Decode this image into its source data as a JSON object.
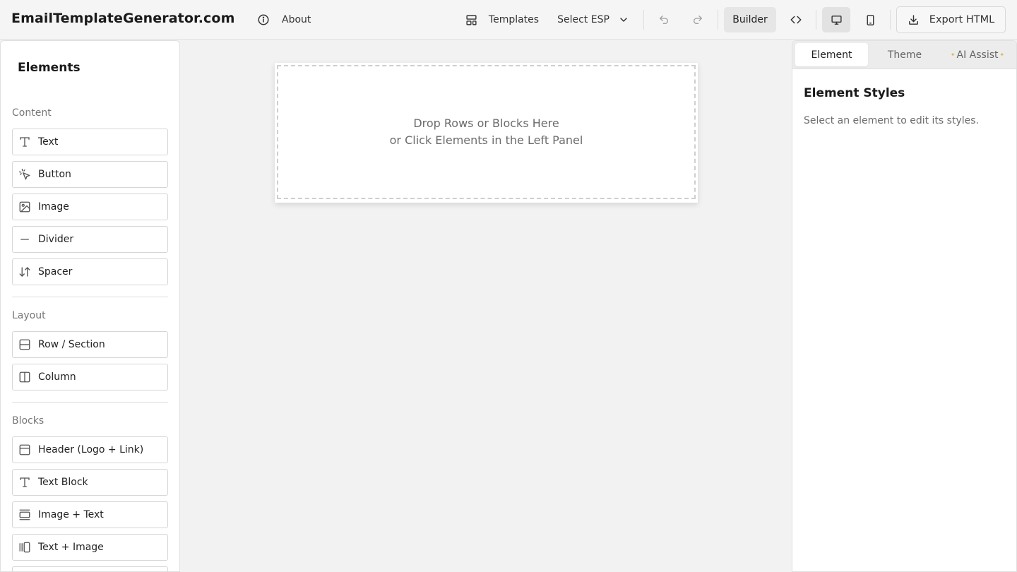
{
  "header": {
    "brand": "EmailTemplateGenerator.com",
    "about_label": "About",
    "templates_label": "Templates",
    "esp_label": "Select ESP",
    "builder_label": "Builder",
    "export_label": "Export HTML",
    "active_view": "Builder",
    "active_device": "desktop"
  },
  "left_panel": {
    "title": "Elements",
    "sections": {
      "content": {
        "label": "Content",
        "items": [
          {
            "label": "Text",
            "icon": "text-icon"
          },
          {
            "label": "Button",
            "icon": "pointer-click-icon"
          },
          {
            "label": "Image",
            "icon": "image-icon"
          },
          {
            "label": "Divider",
            "icon": "minus-icon"
          },
          {
            "label": "Spacer",
            "icon": "arrows-vertical-icon"
          }
        ]
      },
      "layout": {
        "label": "Layout",
        "items": [
          {
            "label": "Row / Section",
            "icon": "row-icon"
          },
          {
            "label": "Column",
            "icon": "column-icon"
          }
        ]
      },
      "blocks": {
        "label": "Blocks",
        "items": [
          {
            "label": "Header (Logo + Link)",
            "icon": "header-layout-icon"
          },
          {
            "label": "Text Block",
            "icon": "text-icon"
          },
          {
            "label": "Image + Text",
            "icon": "image-text-icon"
          },
          {
            "label": "Text + Image",
            "icon": "text-image-icon"
          }
        ]
      }
    }
  },
  "canvas": {
    "drop_line1": "Drop Rows or Blocks Here",
    "drop_line2": "or Click Elements in the Left Panel"
  },
  "right_panel": {
    "tabs": [
      "Element",
      "Theme",
      "AI Assist"
    ],
    "active_tab": "Element",
    "title": "Element Styles",
    "hint": "Select an element to edit its styles."
  }
}
